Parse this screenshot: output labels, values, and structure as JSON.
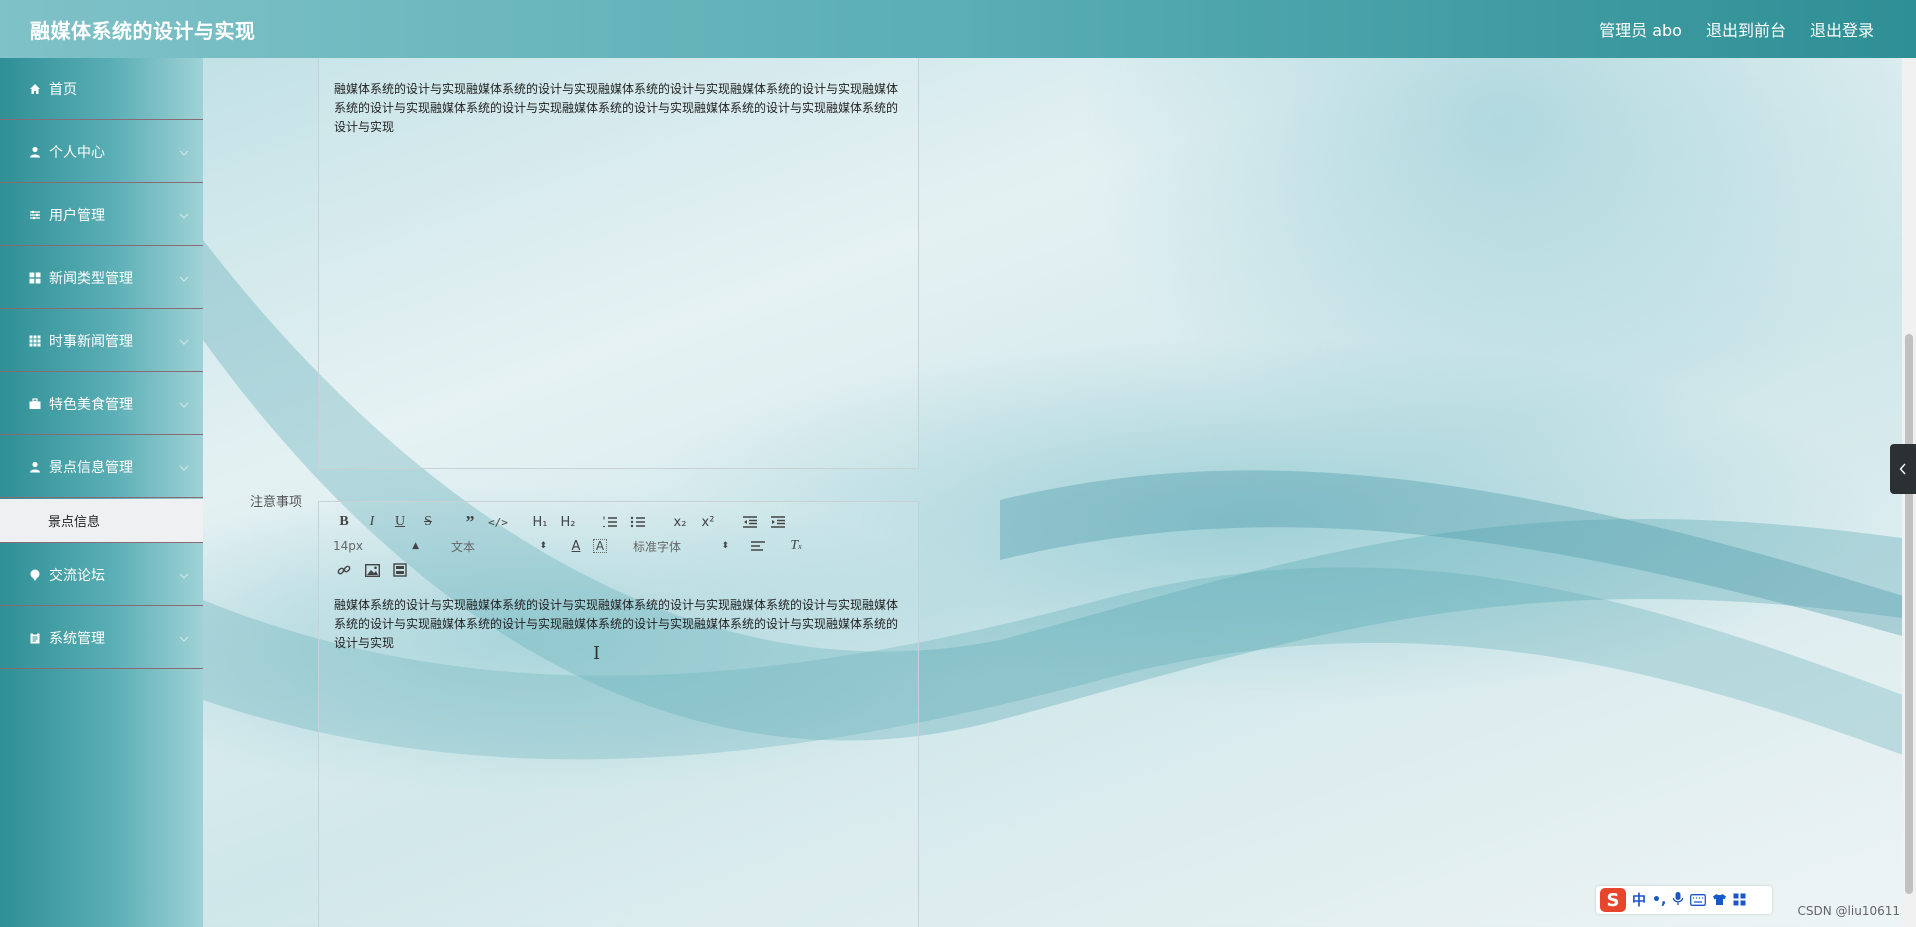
{
  "header": {
    "title": "融媒体系统的设计与实现",
    "user": "管理员 abo",
    "front_link": "退出到前台",
    "logout": "退出登录"
  },
  "sidebar": {
    "items": [
      {
        "label": "首页",
        "icon": "home-icon"
      },
      {
        "label": "个人中心",
        "icon": "person-icon"
      },
      {
        "label": "用户管理",
        "icon": "sliders-icon"
      },
      {
        "label": "新闻类型管理",
        "icon": "grid-icon"
      },
      {
        "label": "时事新闻管理",
        "icon": "grid-dots-icon"
      },
      {
        "label": "特色美食管理",
        "icon": "briefcase-icon"
      },
      {
        "label": "景点信息管理",
        "icon": "person-icon"
      }
    ],
    "active_sub": "景点信息",
    "items_after": [
      {
        "label": "交流论坛",
        "icon": "pin-icon"
      },
      {
        "label": "系统管理",
        "icon": "clipboard-icon"
      }
    ]
  },
  "editor1": {
    "content": "融媒体系统的设计与实现融媒体系统的设计与实现融媒体系统的设计与实现融媒体系统的设计与实现融媒体系统的设计与实现融媒体系统的设计与实现融媒体系统的设计与实现融媒体系统的设计与实现融媒体系统的设计与实现"
  },
  "editor2": {
    "label": "注意事项",
    "font_size": "14px",
    "text_type": "文本",
    "font_family": "标准字体",
    "content": "融媒体系统的设计与实现融媒体系统的设计与实现融媒体系统的设计与实现融媒体系统的设计与实现融媒体系统的设计与实现融媒体系统的设计与实现融媒体系统的设计与实现融媒体系统的设计与实现融媒体系统的设计与实现"
  },
  "ime": {
    "mode": "中",
    "punct": "•,"
  },
  "watermark": "CSDN @liu10611",
  "colors": {
    "header_start": "#7fc2c8",
    "header_end": "#2e8f95",
    "sidebar": "#2e8f95"
  }
}
